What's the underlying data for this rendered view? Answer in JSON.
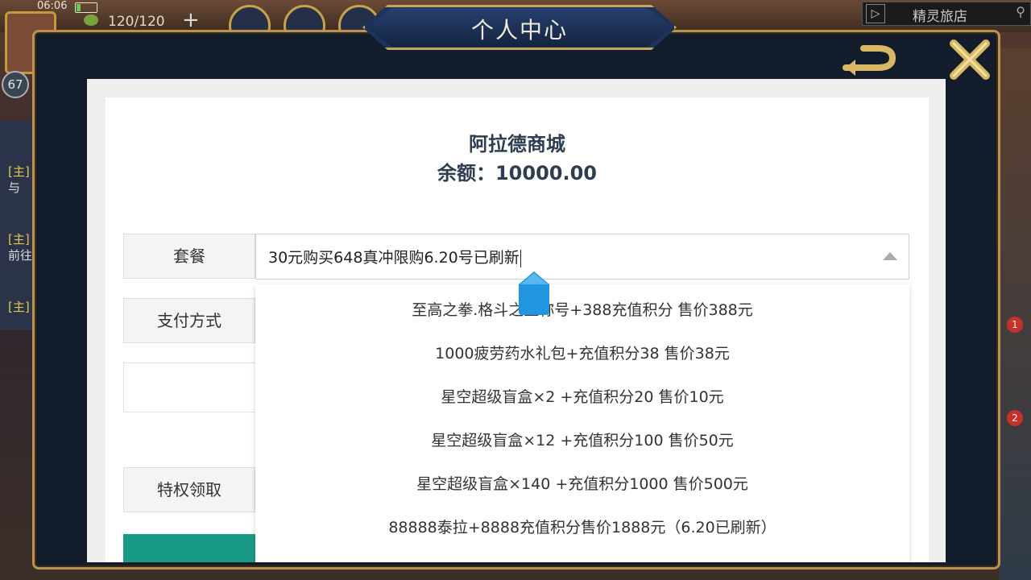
{
  "status_bar": {
    "time": "06:06"
  },
  "game_hud": {
    "stamina": "120/120",
    "level": "67",
    "inn_label": "精灵旅店",
    "side_text": [
      "[主]",
      "与",
      "[主]",
      "前往",
      "[主]"
    ],
    "badges": [
      "1",
      "2"
    ]
  },
  "modal": {
    "title": "个人中心"
  },
  "shop": {
    "title": "阿拉德商城",
    "balance": "余额：10000.00"
  },
  "form": {
    "package_label": "套餐",
    "package_value": "30元购买648真冲限购6.20号已刷新",
    "payment_label": "支付方式",
    "privilege_label": "特权领取"
  },
  "dropdown": {
    "options": [
      "至高之拳.格斗之王称号+388充值积分 售价388元",
      "1000疲劳药水礼包+充值积分38 售价38元",
      "星空超级盲盒×2 +充值积分20 售价10元",
      "星空超级盲盒×12 +充值积分100 售价50元",
      "星空超级盲盒×140 +充值积分1000 售价500元",
      "88888泰拉+8888充值积分售价1888元（6.20已刷新）"
    ]
  },
  "colors": {
    "frame_gold": "#b89450",
    "title_plate": "#1d3259",
    "shop_text": "#2e3e52",
    "submit_teal": "#199a87",
    "cursor_blue": "#2196e0"
  }
}
